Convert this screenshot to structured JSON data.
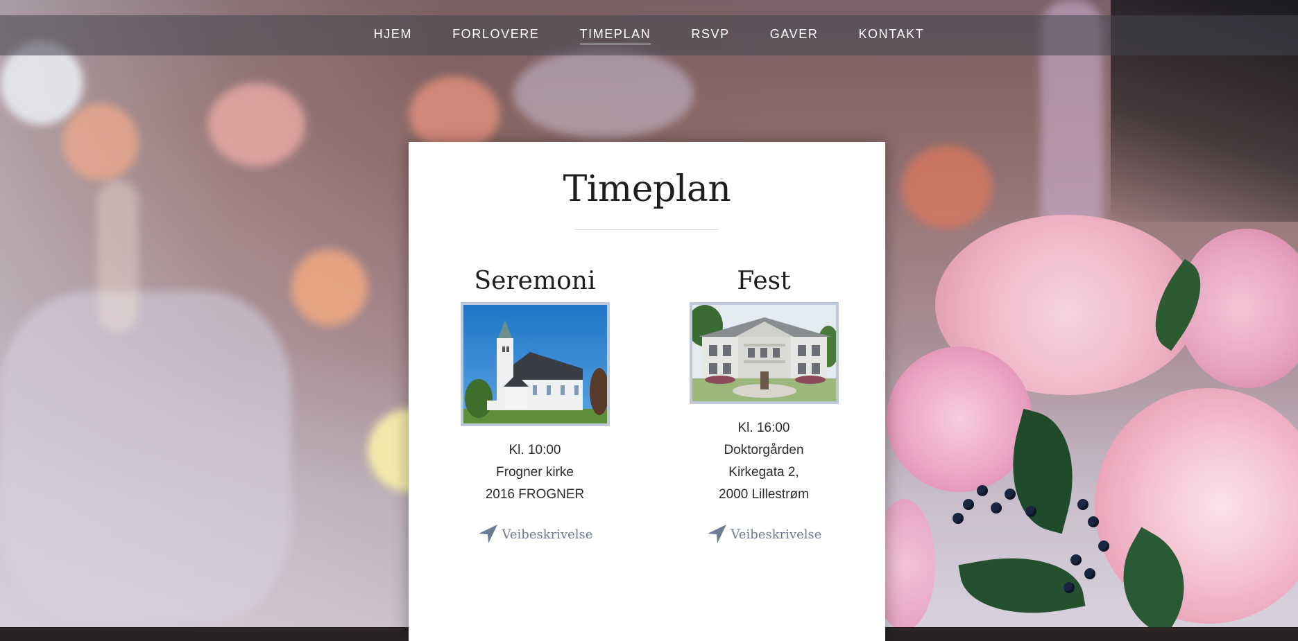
{
  "nav": {
    "items": [
      {
        "label": "HJEM"
      },
      {
        "label": "FORLOVERE"
      },
      {
        "label": "TIMEPLAN",
        "active": true
      },
      {
        "label": "RSVP"
      },
      {
        "label": "GAVER"
      },
      {
        "label": "KONTAKT"
      }
    ]
  },
  "schedule": {
    "title": "Timeplan",
    "events": [
      {
        "title": "Seremoni",
        "time": "Kl. 10:00",
        "address_lines": [
          "Frogner kirke",
          "2016 FROGNER"
        ],
        "directions_label": "Veibeskrivelse",
        "icon": "navigation-arrow-icon"
      },
      {
        "title": "Fest",
        "time": "Kl. 16:00",
        "address_lines": [
          "Doktorgården",
          "Kirkegata 2,",
          "2000 Lillestrøm"
        ],
        "directions_label": "Veibeskrivelse",
        "icon": "navigation-arrow-icon"
      }
    ]
  },
  "colors": {
    "link": "#6b7b93",
    "photo_border": "#bec8d6",
    "card": "#ffffff"
  }
}
